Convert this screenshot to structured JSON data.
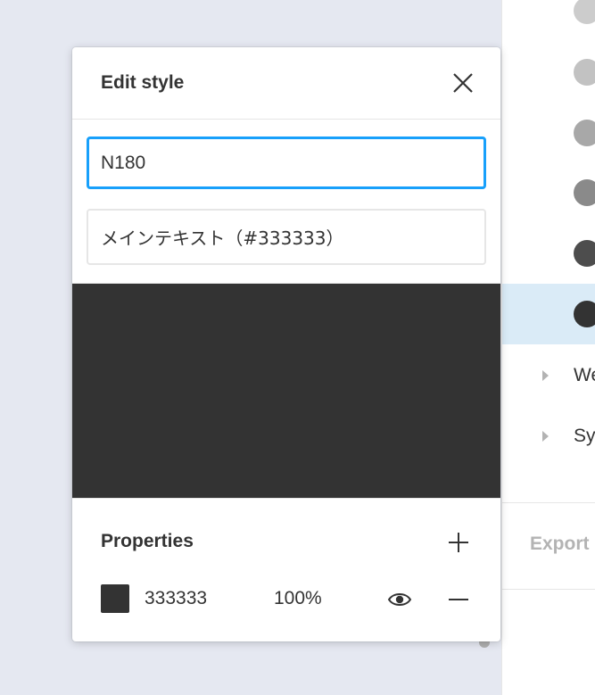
{
  "modal": {
    "title": "Edit style",
    "name_value": "N180",
    "description_value": "メインテキスト（#333333）",
    "preview_color": "#333333",
    "properties_title": "Properties",
    "fill": {
      "hex": "333333",
      "opacity": "100%",
      "swatch_color": "#333333"
    }
  },
  "side_panel": {
    "swatches": [
      {
        "color": "#cccccc"
      },
      {
        "color": "#c2c2c2"
      },
      {
        "color": "#a8a8a8"
      },
      {
        "color": "#8a8a8a"
      },
      {
        "color": "#4d4d4d"
      },
      {
        "color": "#333333",
        "selected": true
      }
    ],
    "groups": [
      {
        "label": "We"
      },
      {
        "label": "Sy"
      }
    ],
    "export_label": "Export"
  },
  "colors": {
    "accent": "#18a0fb",
    "selection": "#daebf7",
    "text": "#333333",
    "muted": "#b3b3b3"
  }
}
